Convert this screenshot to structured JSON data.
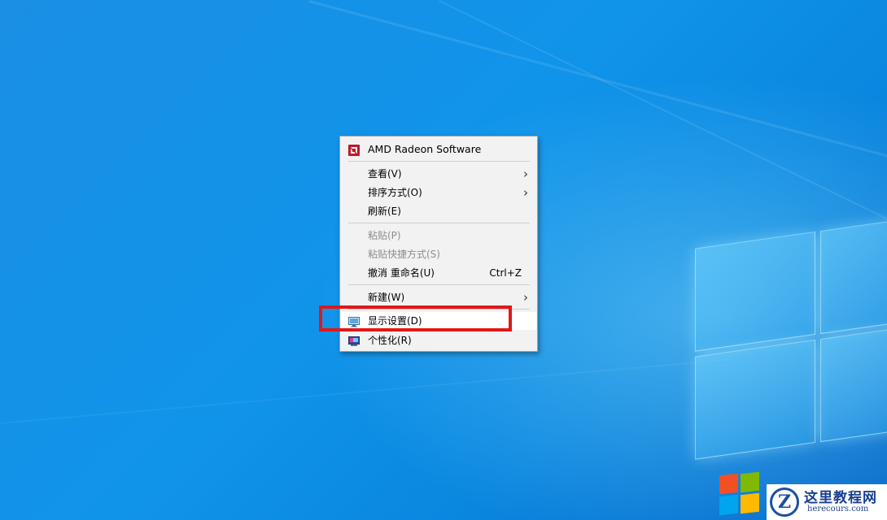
{
  "context_menu": {
    "header": {
      "label": "AMD Radeon Software",
      "icon": "amd-radeon-icon"
    },
    "items": [
      {
        "label": "查看(V)",
        "has_submenu": true
      },
      {
        "label": "排序方式(O)",
        "has_submenu": true
      },
      {
        "label": "刷新(E)"
      },
      {
        "label": "粘贴(P)",
        "disabled": true
      },
      {
        "label": "粘贴快捷方式(S)",
        "disabled": true
      },
      {
        "label": "撤消 重命名(U)",
        "shortcut": "Ctrl+Z"
      },
      {
        "label": "新建(W)",
        "has_submenu": true
      },
      {
        "label": "显示设置(D)",
        "icon": "display-settings-icon",
        "highlighted": true
      },
      {
        "label": "个性化(R)",
        "icon": "personalize-icon"
      }
    ],
    "submenu_arrow": "›"
  },
  "colors": {
    "desktop_blue": "#1094ea",
    "menu_background": "#f2f2f2",
    "annotation_red": "#e01818",
    "amd_red": "#c0182c"
  },
  "watermark": {
    "name": "这里教程网",
    "site": "herecours.com",
    "logo_letter": "Z"
  }
}
